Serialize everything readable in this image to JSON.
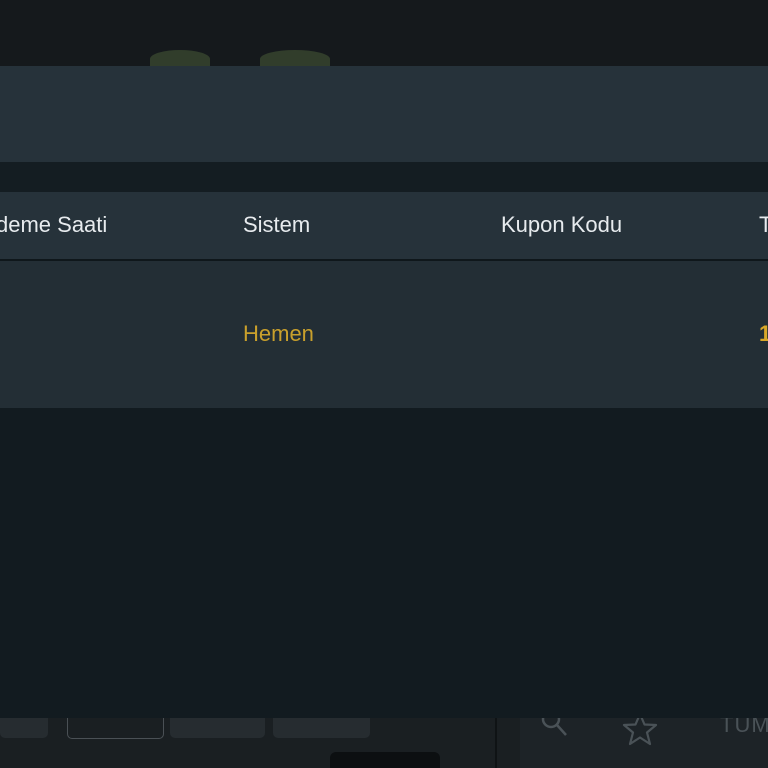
{
  "table": {
    "columns": [
      "deme Saati",
      "Sistem",
      "Kupon Kodu",
      "T"
    ],
    "rows": [
      {
        "odeme_saati": "",
        "sistem": "Hemen",
        "kupon_kodu": "",
        "tutar": "1"
      }
    ]
  },
  "background": {
    "partial_label": "TÜM",
    "icons": [
      "search-icon",
      "star-icon"
    ]
  },
  "colors": {
    "accent": "#c9a02c",
    "modal_header": "#26323a",
    "modal_body": "#121b20"
  }
}
